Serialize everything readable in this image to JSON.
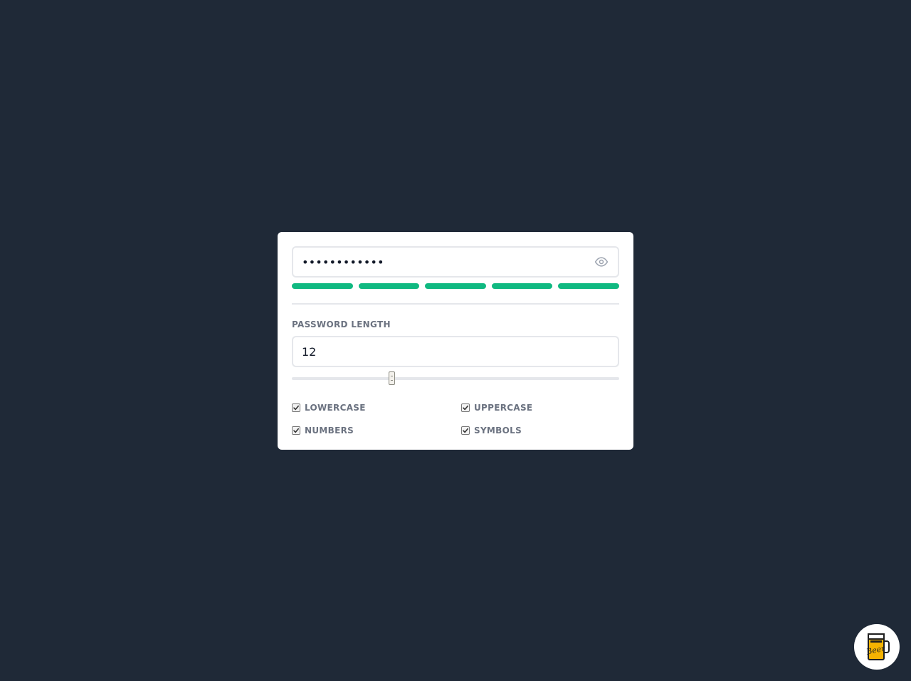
{
  "password": {
    "masked_value": "••••••••••••",
    "toggle_icon": "eye-icon"
  },
  "strength": {
    "segments": 5,
    "filled": 5,
    "fill_color": "#10b981"
  },
  "length": {
    "label": "PASSWORD LENGTH",
    "value": "12",
    "slider": {
      "value": 12,
      "min": 4,
      "max": 24
    }
  },
  "options": [
    {
      "label": "LOWERCASE",
      "checked": true
    },
    {
      "label": "UPPERCASE",
      "checked": true
    },
    {
      "label": "NUMBERS",
      "checked": true
    },
    {
      "label": "SYMBOLS",
      "checked": true
    }
  ],
  "badge": {
    "icon": "beer-mug-icon",
    "text": "Beer"
  },
  "colors": {
    "background": "#1f2937",
    "card": "#ffffff",
    "accent": "#10b981",
    "label": "#6b7280"
  }
}
